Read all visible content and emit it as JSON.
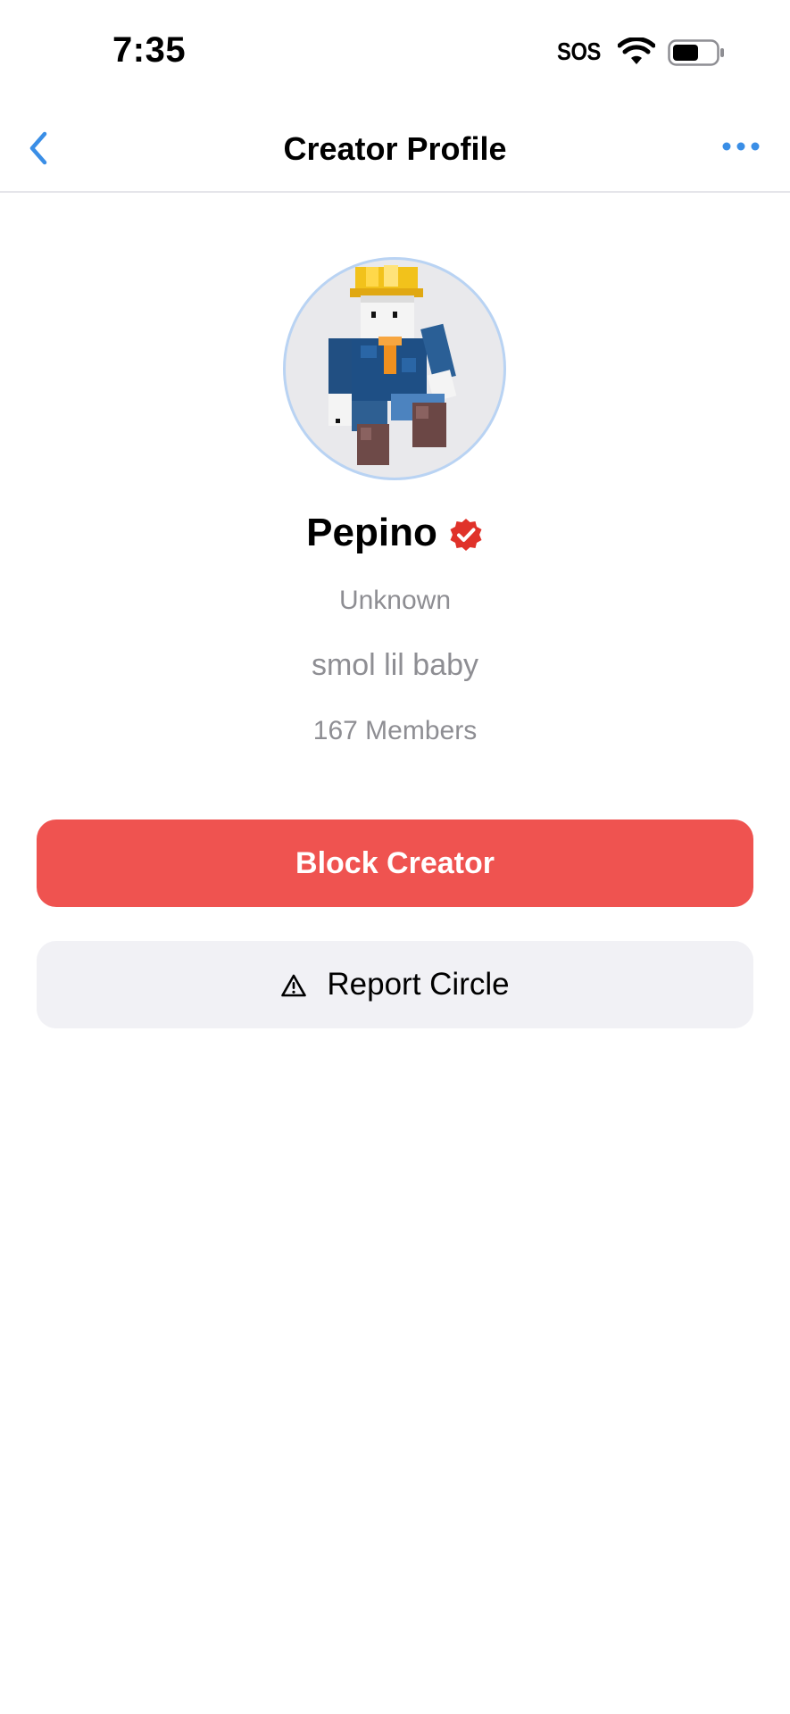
{
  "status_bar": {
    "time": "7:35",
    "sos": "SOS",
    "icons": [
      "wifi-icon",
      "battery-icon"
    ]
  },
  "nav": {
    "title": "Creator Profile",
    "back_icon": "chevron-left-icon",
    "more_icon": "ellipsis-icon",
    "accent_color": "#3a8ee6"
  },
  "profile": {
    "avatar": "minecraft-character-avatar",
    "name": "Pepino",
    "verified_icon": "verified-badge-icon",
    "location": "Unknown",
    "bio": "smol lil baby",
    "members": "167 Members"
  },
  "actions": {
    "block_label": "Block Creator",
    "block_color": "#ef5350",
    "report_label": "Report Circle",
    "report_icon": "warning-triangle-icon"
  }
}
